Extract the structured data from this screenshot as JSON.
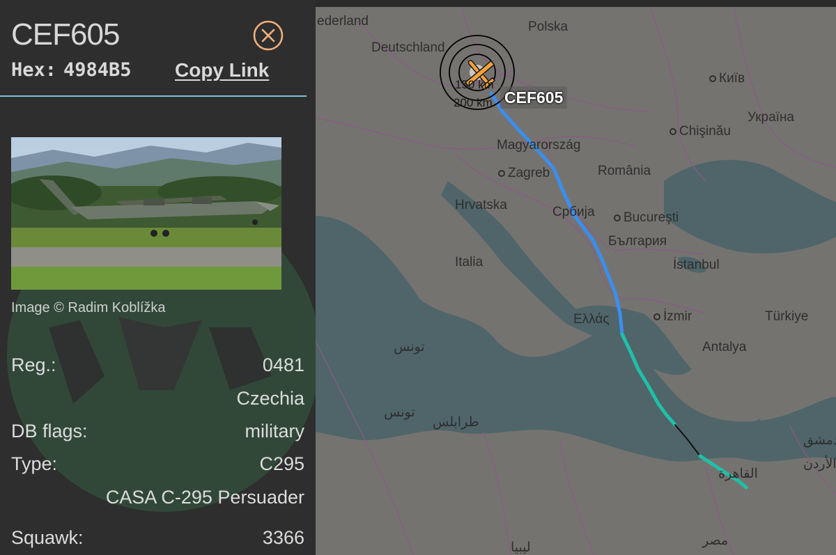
{
  "aircraft": {
    "callsign": "CEF605",
    "hex_label": "Hex:",
    "hex": "4984B5",
    "copy_link": "Copy Link",
    "photo_credit": "Image © Radim Koblížka"
  },
  "details": {
    "reg_label": "Reg.:",
    "reg_value": "0481",
    "country": "Czechia",
    "db_flags_label": "DB flags:",
    "db_flags_value": "military",
    "type_label": "Type:",
    "type_value": "C295",
    "type_description": "CASA C-295 Persuader",
    "squawk_label": "Squawk:",
    "squawk_value": "3366"
  },
  "map": {
    "flight_label": "CEF605",
    "range_1": "150 km",
    "range_2": "200 km",
    "labels": {
      "nederland": "ederland",
      "polska": "Polska",
      "deutschland": "Deutschland",
      "kyiv": "Київ",
      "ukraina": "Україна",
      "magyarorszag": "Magyarország",
      "chisinau": "Chişinău",
      "zagreb": "Zagreb",
      "romania": "România",
      "hrvatska": "Hrvatska",
      "srbija": "Србија",
      "bucuresti": "Bucureşti",
      "bulgaria": "България",
      "italia": "Italia",
      "istanbul": "İstanbul",
      "ellada": "Ελλάς",
      "izmir": "İzmir",
      "turkiye": "Türkiye",
      "antalya": "Antalya",
      "tunis_city": "تونس",
      "tunis_country": "تونس",
      "tarabulus": "طرابلس",
      "dimashq": "دمشق",
      "al_urdun": "الأردن",
      "al_qahira": "القاهرة",
      "misr": "مصر",
      "libya": "ليبيا"
    }
  },
  "colors": {
    "panel_bg": "#2e2e2e",
    "accent_rule": "#7ac7d6",
    "close_icon": "#f3b07a",
    "track_high": "#3a8ff0",
    "track_low": "#20c0a8",
    "aircraft_icon": "#f5a13a"
  }
}
